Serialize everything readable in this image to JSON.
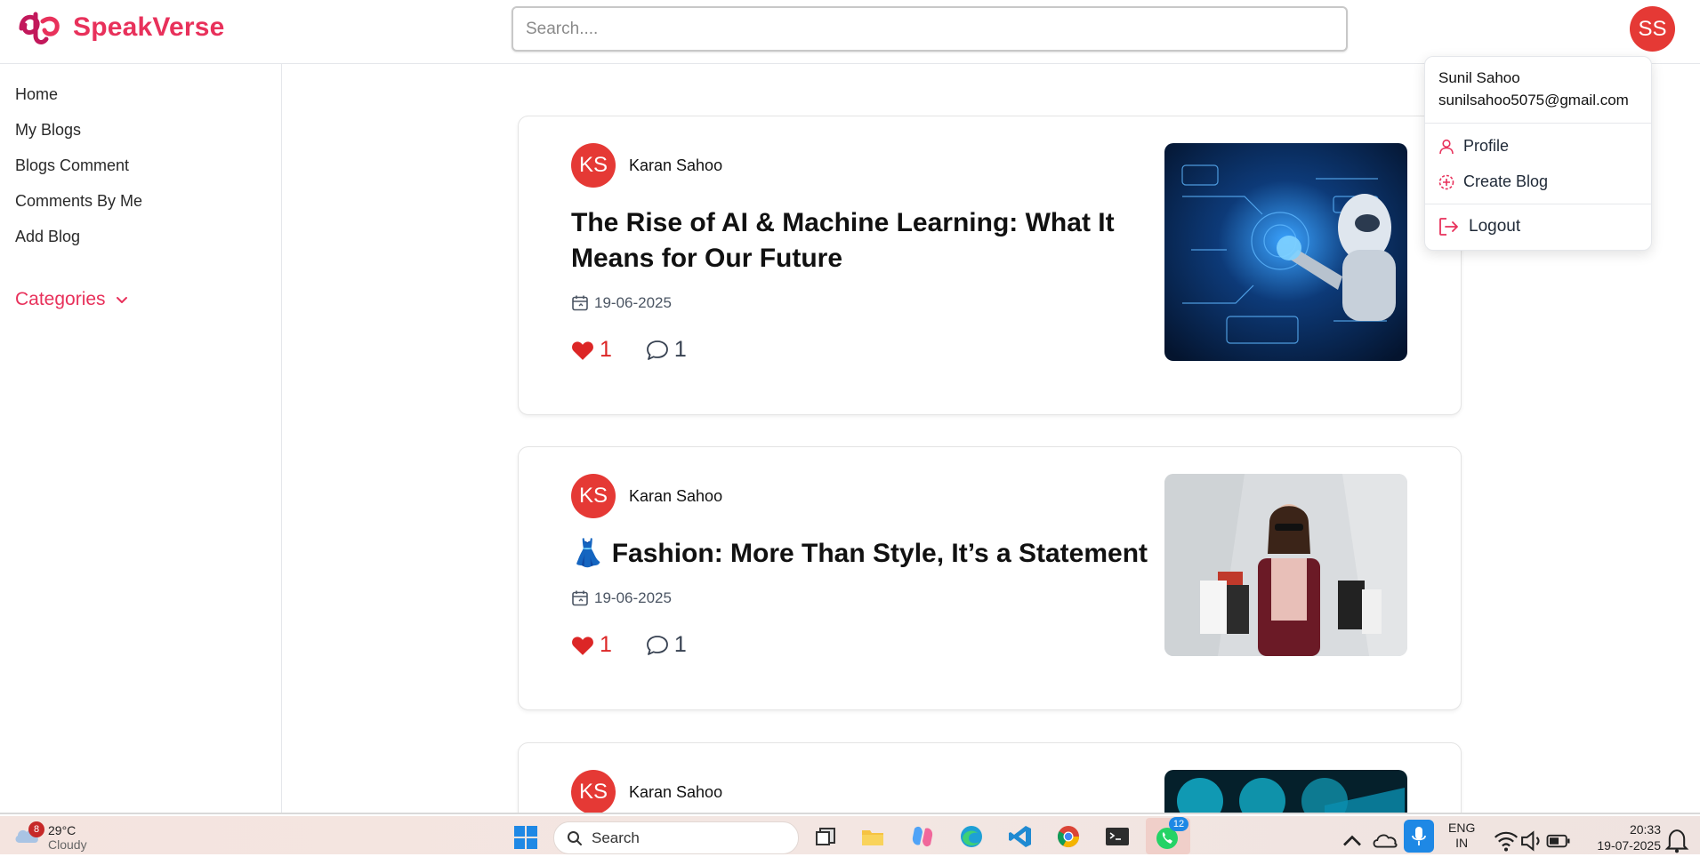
{
  "app": {
    "brand": "SpeakVerse"
  },
  "header": {
    "search_placeholder": "Search....",
    "user_initials": "SS"
  },
  "sidebar": {
    "items": [
      {
        "label": "Home"
      },
      {
        "label": "My Blogs"
      },
      {
        "label": "Blogs Comment"
      },
      {
        "label": "Comments By Me"
      },
      {
        "label": "Add Blog"
      }
    ],
    "categories_label": "Categories"
  },
  "posts": [
    {
      "author_initials": "KS",
      "author": "Karan Sahoo",
      "title": "The Rise of AI & Machine Learning: What It Means for Our Future",
      "date": "19-06-2025",
      "likes": "1",
      "comments": "1",
      "image_icon": "ai-robot-image"
    },
    {
      "author_initials": "KS",
      "author": "Karan Sahoo",
      "title": "👗 Fashion: More Than Style, It’s a Statement",
      "date": "19-06-2025",
      "likes": "1",
      "comments": "1",
      "image_icon": "fashion-shopping-image"
    },
    {
      "author_initials": "KS",
      "author": "Karan Sahoo",
      "image_icon": "web-development-image"
    }
  ],
  "user_menu": {
    "name": "Sunil Sahoo",
    "email": "sunilsahoo5075@gmail.com",
    "items": [
      {
        "label": "Profile",
        "icon": "user-icon"
      },
      {
        "label": "Create Blog",
        "icon": "plus-circle-icon"
      },
      {
        "label": "Logout",
        "icon": "logout-icon"
      }
    ]
  },
  "taskbar": {
    "weather_badge": "8",
    "temperature": "29°C",
    "weather": "Cloudy",
    "search_label": "Search",
    "whatsapp_badge": "12",
    "language": "ENG",
    "region": "IN",
    "time": "20:33",
    "date": "19-07-2025"
  },
  "colors": {
    "brand": "#e8315b",
    "avatar": "#e53935",
    "like": "#dc2626"
  }
}
